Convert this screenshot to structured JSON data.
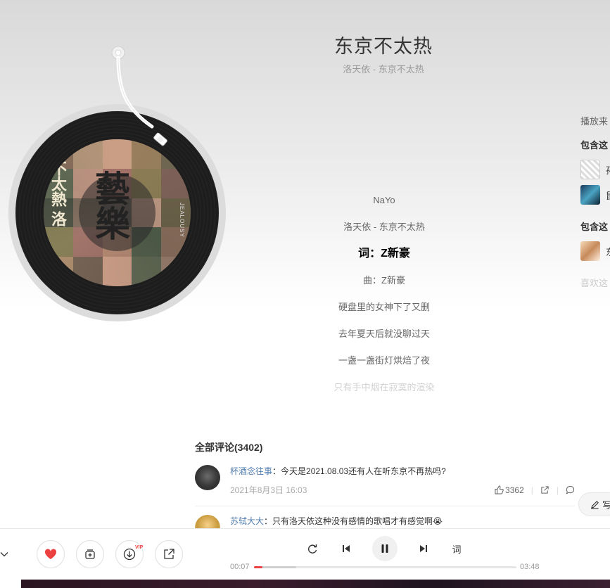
{
  "song": {
    "title": "东京不太热",
    "subtitle": "洛天依 - 东京不太热"
  },
  "cover": {
    "glyph": "藝樂",
    "side_text": "不太熱 洛",
    "brand": "JEALOUSY"
  },
  "lyrics": [
    {
      "text": "NaYo",
      "state": "normal"
    },
    {
      "text": "洛天依 - 东京不太热",
      "state": "normal"
    },
    {
      "text": "词：Z新豪",
      "state": "active"
    },
    {
      "text": "曲：Z新豪",
      "state": "normal"
    },
    {
      "text": "硬盘里的女神下了又删",
      "state": "normal"
    },
    {
      "text": "去年夏天后就没聊过天",
      "state": "normal"
    },
    {
      "text": "一盏一盏街灯烘焙了夜",
      "state": "normal"
    },
    {
      "text": "只有手中烟在寂寞的渲染",
      "state": "fade"
    }
  ],
  "side_panel": {
    "source_label": "播放来",
    "playlist_head": "包含这",
    "playlist_items": [
      "孙",
      "鼠"
    ],
    "similar_head": "包含这",
    "similar_items": [
      "东"
    ],
    "like_label": "喜欢这"
  },
  "comments": {
    "title": "全部评论(3402)",
    "items": [
      {
        "user": "杯酒念往事",
        "text": "：今天是2021.08.03还有人在听东京不再热吗?",
        "time": "2021年8月3日 16:03",
        "likes": "3362"
      },
      {
        "user": "苏轼大大",
        "text": "：只有洛天依这种没有感情的歌唱才有感觉啊😭",
        "time": "",
        "likes": ""
      }
    ],
    "write_label": "写"
  },
  "player": {
    "current_time": "00:07",
    "total_time": "03:48",
    "progress": 0.031,
    "buffered": 0.16,
    "lyric_label": "词",
    "vip_label": "VIP"
  },
  "colors": {
    "accent": "#ec4141",
    "link": "#507daf"
  }
}
